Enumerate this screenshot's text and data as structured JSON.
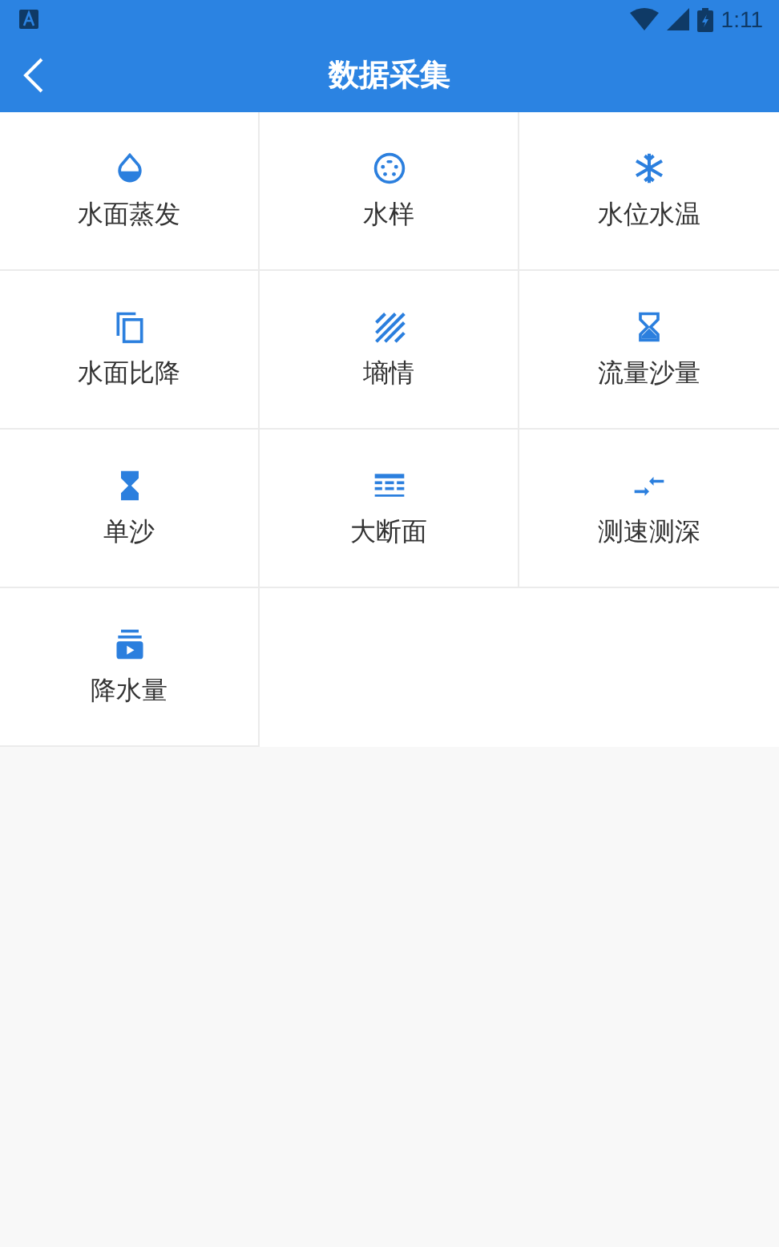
{
  "status_bar": {
    "time": "1:11"
  },
  "header": {
    "title": "数据采集"
  },
  "items": [
    {
      "label": "水面蒸发",
      "kind": "drop"
    },
    {
      "label": "水样",
      "kind": "sample"
    },
    {
      "label": "水位水温",
      "kind": "snow"
    },
    {
      "label": "水面比降",
      "kind": "copy"
    },
    {
      "label": "墒情",
      "kind": "hatch"
    },
    {
      "label": "流量沙量",
      "kind": "hourglass"
    },
    {
      "label": "单沙",
      "kind": "hourglass-filled"
    },
    {
      "label": "大断面",
      "kind": "section"
    },
    {
      "label": "测速测深",
      "kind": "arrows"
    },
    {
      "label": "降水量",
      "kind": "media"
    }
  ]
}
